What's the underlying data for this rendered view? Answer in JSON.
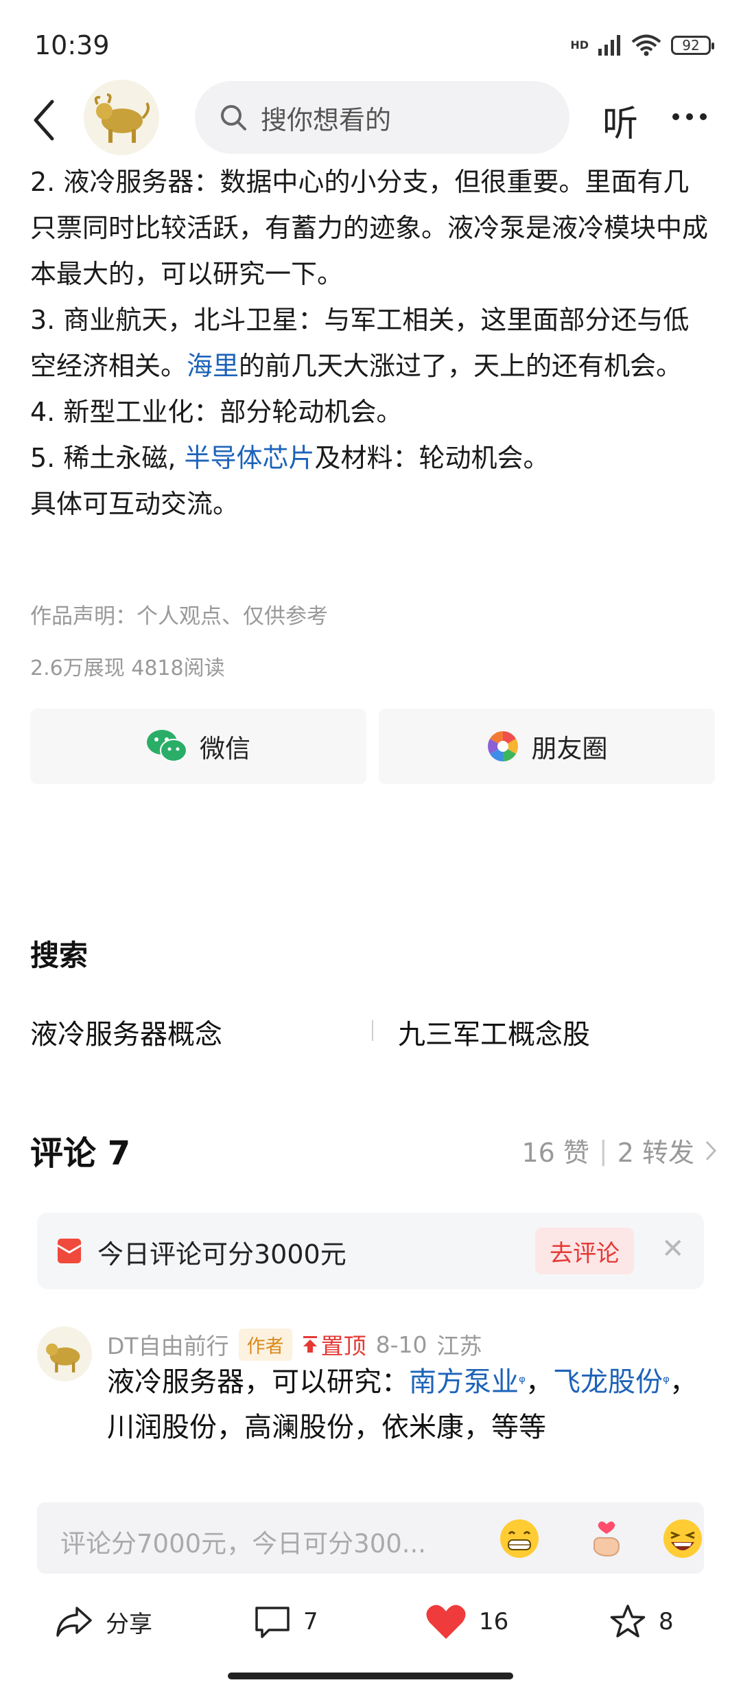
{
  "status_bar": {
    "time": "10:39",
    "hd": "HD",
    "battery": "92"
  },
  "top_nav": {
    "search_placeholder": "搜你想看的",
    "listen_label": "听"
  },
  "article": {
    "p2_pre": "2. 液冷服务器：数据中心的小分支，但很重要。里面有几只票同时比较活跃，有蓄力的迹象。液冷泵是液冷模块中成本最大的，可以研究一下。",
    "p3_pre": "3. 商业航天，北斗卫星：与军工相关，这里面部分还与低空经济相关。",
    "p3_link": "海里",
    "p3_post": "的前几天大涨过了，天上的还有机会。",
    "p4": "4. 新型工业化：部分轮动机会。",
    "p5_pre": "5. 稀土永磁, ",
    "p5_link": "半导体芯片",
    "p5_post": "及材料：轮动机会。",
    "p6": "具体可互动交流。"
  },
  "meta": {
    "statement": "作品声明：个人观点、仅供参考",
    "stats": "2.6万展现   4818阅读"
  },
  "share_buttons": {
    "wechat": "微信",
    "moments": "朋友圈"
  },
  "search_section": {
    "title": "搜索",
    "links": [
      "液冷服务器概念",
      "九三军工概念股"
    ]
  },
  "comments": {
    "title": "评论 7",
    "likes": "16 赞",
    "reposts": "2 转发",
    "banner": {
      "text": "今日评论可分3000元",
      "button": "去评论"
    },
    "items": [
      {
        "author": "DT自由前行",
        "author_tag": "作者",
        "pinned": "置顶",
        "date": "8-10",
        "location": "江苏",
        "text_pre": "液冷服务器，可以研究：",
        "link1": "南方泵业",
        "sep": "，",
        "link2": "飞龙股份",
        "text_post": "，川润股份，高澜股份，依米康，等等"
      }
    ],
    "input_placeholder": "评论分7000元，今日可分300..."
  },
  "bottom_bar": {
    "share": "分享",
    "comments": "7",
    "likes": "16",
    "favorites": "8"
  },
  "colors": {
    "link": "#1d63b8",
    "accent_red": "#e53935",
    "like_red": "#ef3b3b"
  }
}
